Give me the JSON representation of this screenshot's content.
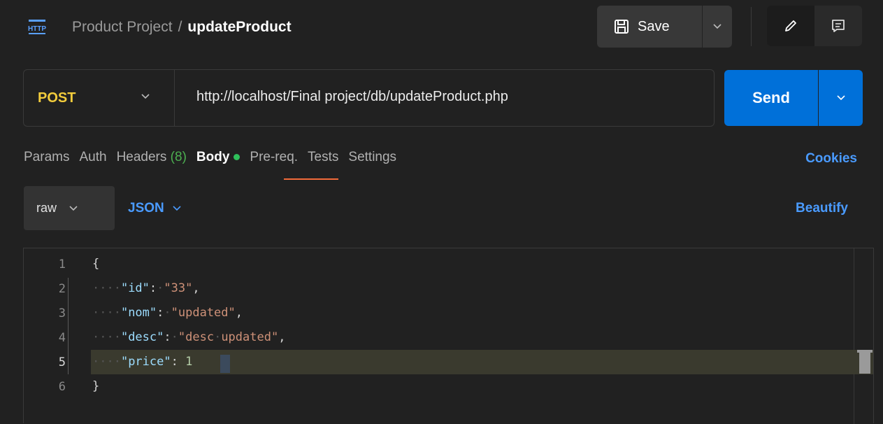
{
  "header": {
    "icon_label": "HTTP",
    "collection": "Product Project",
    "separator": "/",
    "request_name": "updateProduct",
    "save_label": "Save"
  },
  "request": {
    "method": "POST",
    "url": "http://localhost/Final project/db/updateProduct.php",
    "send_label": "Send"
  },
  "tabs": {
    "params": "Params",
    "auth": "Auth",
    "headers": "Headers",
    "headers_count": "(8)",
    "body": "Body",
    "prereq": "Pre-req.",
    "tests": "Tests",
    "settings": "Settings",
    "cookies": "Cookies"
  },
  "body_options": {
    "mode": "raw",
    "format": "JSON",
    "beautify": "Beautify"
  },
  "editor": {
    "line_numbers": [
      "1",
      "2",
      "3",
      "4",
      "5",
      "6"
    ],
    "current_line": "5"
  },
  "colors": {
    "method": "#f2cc3c",
    "send": "#0070d9",
    "link": "#4a9bff",
    "active_tab_underline": "#f26b3a",
    "body_dot": "#2fbf5a"
  }
}
